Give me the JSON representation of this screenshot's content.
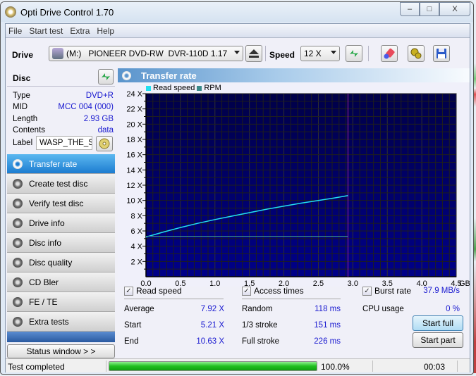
{
  "window": {
    "title": "Opti Drive Control 1.70",
    "minimize": "‒",
    "maximize": "□",
    "close": "X"
  },
  "menu": [
    "File",
    "Start test",
    "Extra",
    "Help"
  ],
  "toolbar": {
    "drive_label": "Drive",
    "drive_value": "(M:)   PIONEER DVD-RW  DVR-110D 1.17",
    "speed_label": "Speed",
    "speed_value": "12 X"
  },
  "disc": {
    "title": "Disc",
    "rows": [
      {
        "label": "Type",
        "value": "DVD+R"
      },
      {
        "label": "MID",
        "value": "MCC 004 (000)"
      },
      {
        "label": "Length",
        "value": "2.93 GB"
      },
      {
        "label": "Contents",
        "value": "data"
      }
    ],
    "label_caption": "Label",
    "label_value": "WASP_THE_STI"
  },
  "nav": [
    {
      "label": "Transfer rate",
      "active": true
    },
    {
      "label": "Create test disc"
    },
    {
      "label": "Verify test disc"
    },
    {
      "label": "Drive info"
    },
    {
      "label": "Disc info"
    },
    {
      "label": "Disc quality"
    },
    {
      "label": "CD Bler"
    },
    {
      "label": "FE / TE"
    },
    {
      "label": "Extra tests"
    }
  ],
  "status_window_button": "Status window > >",
  "panel": {
    "title": "Transfer rate"
  },
  "colors": {
    "read_speed": "#22e0f0",
    "rpm": "#3a8a8a",
    "plot_bg": "#000070",
    "grid": "#202020",
    "marker": "#a020a0",
    "value_blue": "#1a1ad0",
    "progress": "#20c020"
  },
  "chart_data": {
    "type": "line",
    "title": "Transfer rate",
    "legend": [
      "Read speed",
      "RPM"
    ],
    "legend_position": "top-left",
    "xlabel": "GB",
    "ylabel": "X",
    "xlim": [
      0,
      4.5
    ],
    "ylim": [
      0,
      24
    ],
    "x_ticks": [
      "0.0",
      "0.5",
      "1.0",
      "1.5",
      "2.0",
      "2.5",
      "3.0",
      "3.5",
      "4.0",
      "4.5"
    ],
    "x_unit": "GB",
    "y_ticks": [
      "2 X",
      "4 X",
      "6 X",
      "8 X",
      "10 X",
      "12 X",
      "14 X",
      "16 X",
      "18 X",
      "20 X",
      "22 X",
      "24 X"
    ],
    "grid": true,
    "series": [
      {
        "name": "Read speed",
        "x": [
          0,
          0.25,
          0.5,
          0.75,
          1.0,
          1.25,
          1.5,
          1.75,
          2.0,
          2.25,
          2.5,
          2.75,
          2.93
        ],
        "y": [
          5.21,
          5.85,
          6.45,
          7.0,
          7.5,
          7.95,
          8.4,
          8.85,
          9.25,
          9.65,
          10.0,
          10.35,
          10.63
        ]
      },
      {
        "name": "RPM",
        "x": [
          0,
          0.5,
          1.0,
          1.5,
          2.0,
          2.5,
          2.93
        ],
        "y": [
          5.3,
          5.3,
          5.3,
          5.3,
          5.3,
          5.3,
          5.3
        ]
      }
    ],
    "marker_x": 2.93
  },
  "stats": {
    "read_speed": {
      "label": "Read speed",
      "checked": true,
      "rows": [
        {
          "label": "Average",
          "value": "7.92 X"
        },
        {
          "label": "Start",
          "value": "5.21 X"
        },
        {
          "label": "End",
          "value": "10.63 X"
        }
      ]
    },
    "access_times": {
      "label": "Access times",
      "checked": true,
      "rows": [
        {
          "label": "Random",
          "value": "118 ms"
        },
        {
          "label": "1/3 stroke",
          "value": "151 ms"
        },
        {
          "label": "Full stroke",
          "value": "226 ms"
        }
      ]
    },
    "burst": {
      "label": "Burst rate",
      "checked": true,
      "value": "37.9 MB/s"
    },
    "cpu": {
      "label": "CPU usage",
      "value": "0 %"
    },
    "start_full": "Start full",
    "start_part": "Start part"
  },
  "statusbar": {
    "text": "Test completed",
    "progress": 100,
    "progress_text": "100.0%",
    "time": "00:03"
  }
}
